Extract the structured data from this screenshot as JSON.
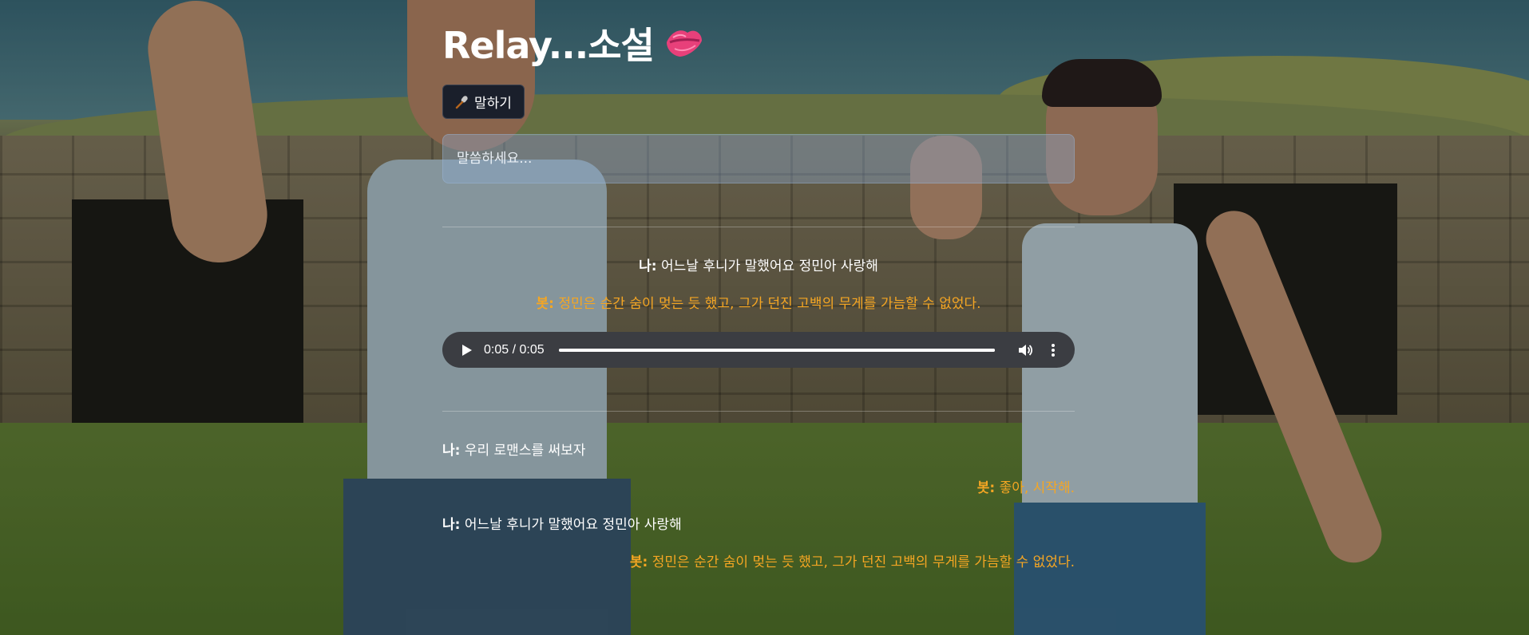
{
  "header": {
    "title": "Relay...소설",
    "title_emoji": "kiss-mark-icon"
  },
  "controls": {
    "speak_button_label": "말하기",
    "speak_button_icon": "microphone-icon",
    "input_placeholder": "말씀하세요..."
  },
  "latest": {
    "me": {
      "speaker": "나:",
      "text": "어느날 후니가 말했어요 정민아 사랑해"
    },
    "bot": {
      "speaker": "봇:",
      "text": "정민은 순간 숨이 멎는 듯 했고, 그가 던진 고백의 무게를 가늠할 수 없었다."
    }
  },
  "audio_player": {
    "time_display": "0:05 / 0:05",
    "progress_fraction": 1.0
  },
  "history": [
    {
      "role": "me",
      "speaker": "나:",
      "text": "우리 로맨스를 써보자"
    },
    {
      "role": "bot",
      "speaker": "봇:",
      "text": "좋아, 시작해."
    },
    {
      "role": "me",
      "speaker": "나:",
      "text": "어느날 후니가 말했어요 정민아 사랑해"
    },
    {
      "role": "bot",
      "speaker": "봇:",
      "text": "정민은 순간 숨이 멎는 듯 했고, 그가 던진 고백의 무게를 가늠할 수 없었다."
    }
  ],
  "colors": {
    "bot_text": "#f5a623",
    "me_text": "#ffffff",
    "button_bg": "#1a1f2b",
    "player_bg": "#3b3d42"
  }
}
